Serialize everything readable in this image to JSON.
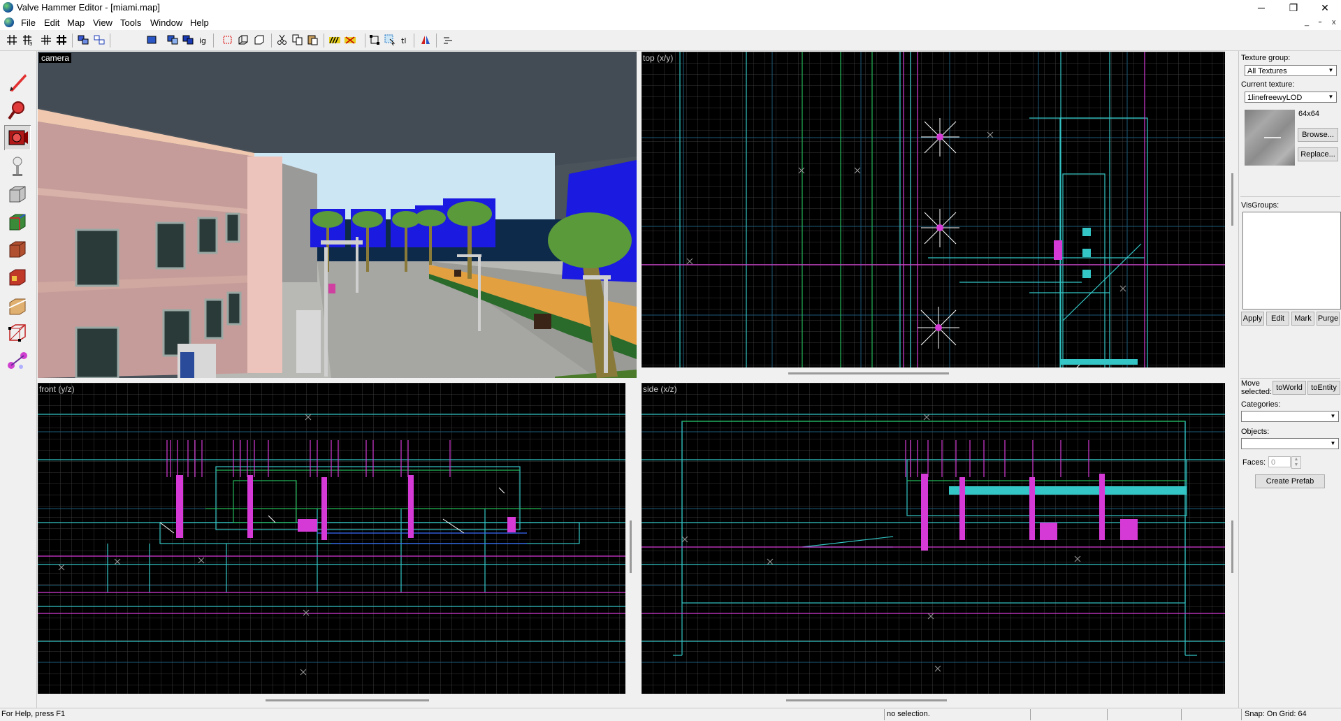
{
  "window": {
    "title": "Valve Hammer Editor - [miami.map]",
    "minimize_glyph": "─",
    "maximize_glyph": "❐",
    "close_glyph": "✕"
  },
  "menu": {
    "items": [
      "File",
      "Edit",
      "Map",
      "View",
      "Tools",
      "Window",
      "Help"
    ],
    "mdi_min": "_",
    "mdi_restore": "▫",
    "mdi_close": "x"
  },
  "viewports": {
    "camera": "camera",
    "top": "top (x/y)",
    "front": "front (y/z)",
    "side": "side (x/z)"
  },
  "texture_panel": {
    "group_label": "Texture group:",
    "group_value": "All Textures",
    "current_label": "Current texture:",
    "current_value": "1linefreewyLOD",
    "size": "64x64",
    "browse": "Browse...",
    "replace": "Replace..."
  },
  "visgroups": {
    "label": "VisGroups:",
    "buttons": [
      "Apply",
      "Edit",
      "Mark",
      "Purge"
    ]
  },
  "move_panel": {
    "label": "Move selected:",
    "to_world": "toWorld",
    "to_entity": "toEntity",
    "categories_label": "Categories:",
    "objects_label": "Objects:",
    "faces_label": "Faces:",
    "faces_value": "0",
    "create_prefab": "Create Prefab"
  },
  "statusbar": {
    "help": "For Help, press F1",
    "selection": "no selection.",
    "snap": "Snap: On Grid: 64"
  },
  "colors": {
    "grid": "#3a3a3a",
    "grid_major": "#1d5a7a",
    "brush_cyan": "#34c6c6",
    "brush_green": "#23b85a",
    "entity_magenta": "#d63ad6",
    "selection_white": "#ffffff"
  }
}
